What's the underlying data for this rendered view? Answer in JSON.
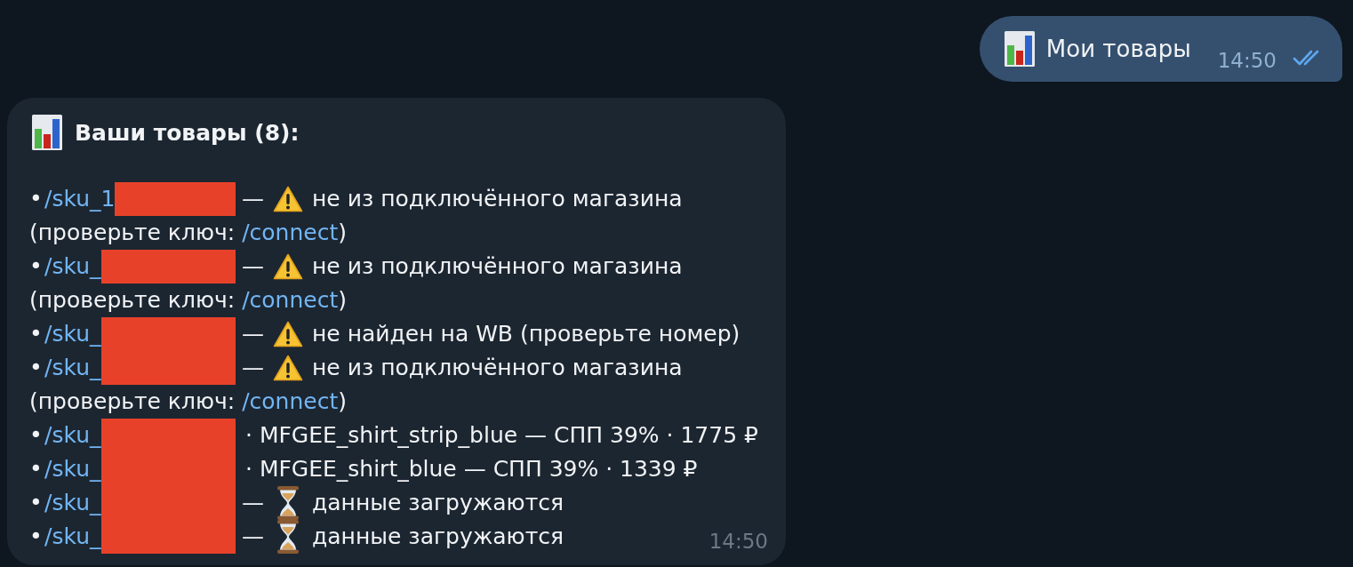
{
  "outgoing": {
    "text": "Мои товары",
    "time": "14:50",
    "read": true
  },
  "incoming": {
    "title": "Ваши товары (8):",
    "time": "14:50",
    "items": [
      {
        "kind": "warning",
        "bullet": "•",
        "sku": "/sku_1",
        "redacted": true,
        "dash": "—",
        "status": "не из подключённого магазина",
        "note": {
          "before": "(проверьте ключ:",
          "link": "/connect",
          "after": ")"
        }
      },
      {
        "kind": "warning",
        "bullet": "•",
        "sku": "/sku_",
        "redacted": true,
        "dash": "—",
        "status": "не из подключённого магазина",
        "note": {
          "before": "(проверьте ключ:",
          "link": "/connect",
          "after": ")"
        }
      },
      {
        "kind": "warning",
        "bullet": "•",
        "sku": "/sku_",
        "redacted": true,
        "dash": "—",
        "status": "не найден на WB (проверьте номер)"
      },
      {
        "kind": "warning",
        "bullet": "•",
        "sku": "/sku_",
        "redacted": true,
        "dash": "—",
        "status": "не из подключённого магазина",
        "note": {
          "before": "(проверьте ключ:",
          "link": "/connect",
          "after": ")"
        }
      },
      {
        "kind": "product",
        "bullet": "•",
        "sku": "/sku_",
        "redacted": true,
        "details": "· MFGEE_shirt_strip_blue — СПП 39% · 1775 ₽"
      },
      {
        "kind": "product",
        "bullet": "•",
        "sku": "/sku_",
        "redacted": true,
        "details": "· MFGEE_shirt_blue — СПП 39% · 1339 ₽"
      },
      {
        "kind": "pending",
        "bullet": "•",
        "sku": "/sku_",
        "redacted": true,
        "dash": "—",
        "status": "данные загружаются"
      },
      {
        "kind": "pending",
        "bullet": "•",
        "sku": "/sku_",
        "redacted": true,
        "dash": "—",
        "status": "данные загружаются"
      }
    ]
  }
}
